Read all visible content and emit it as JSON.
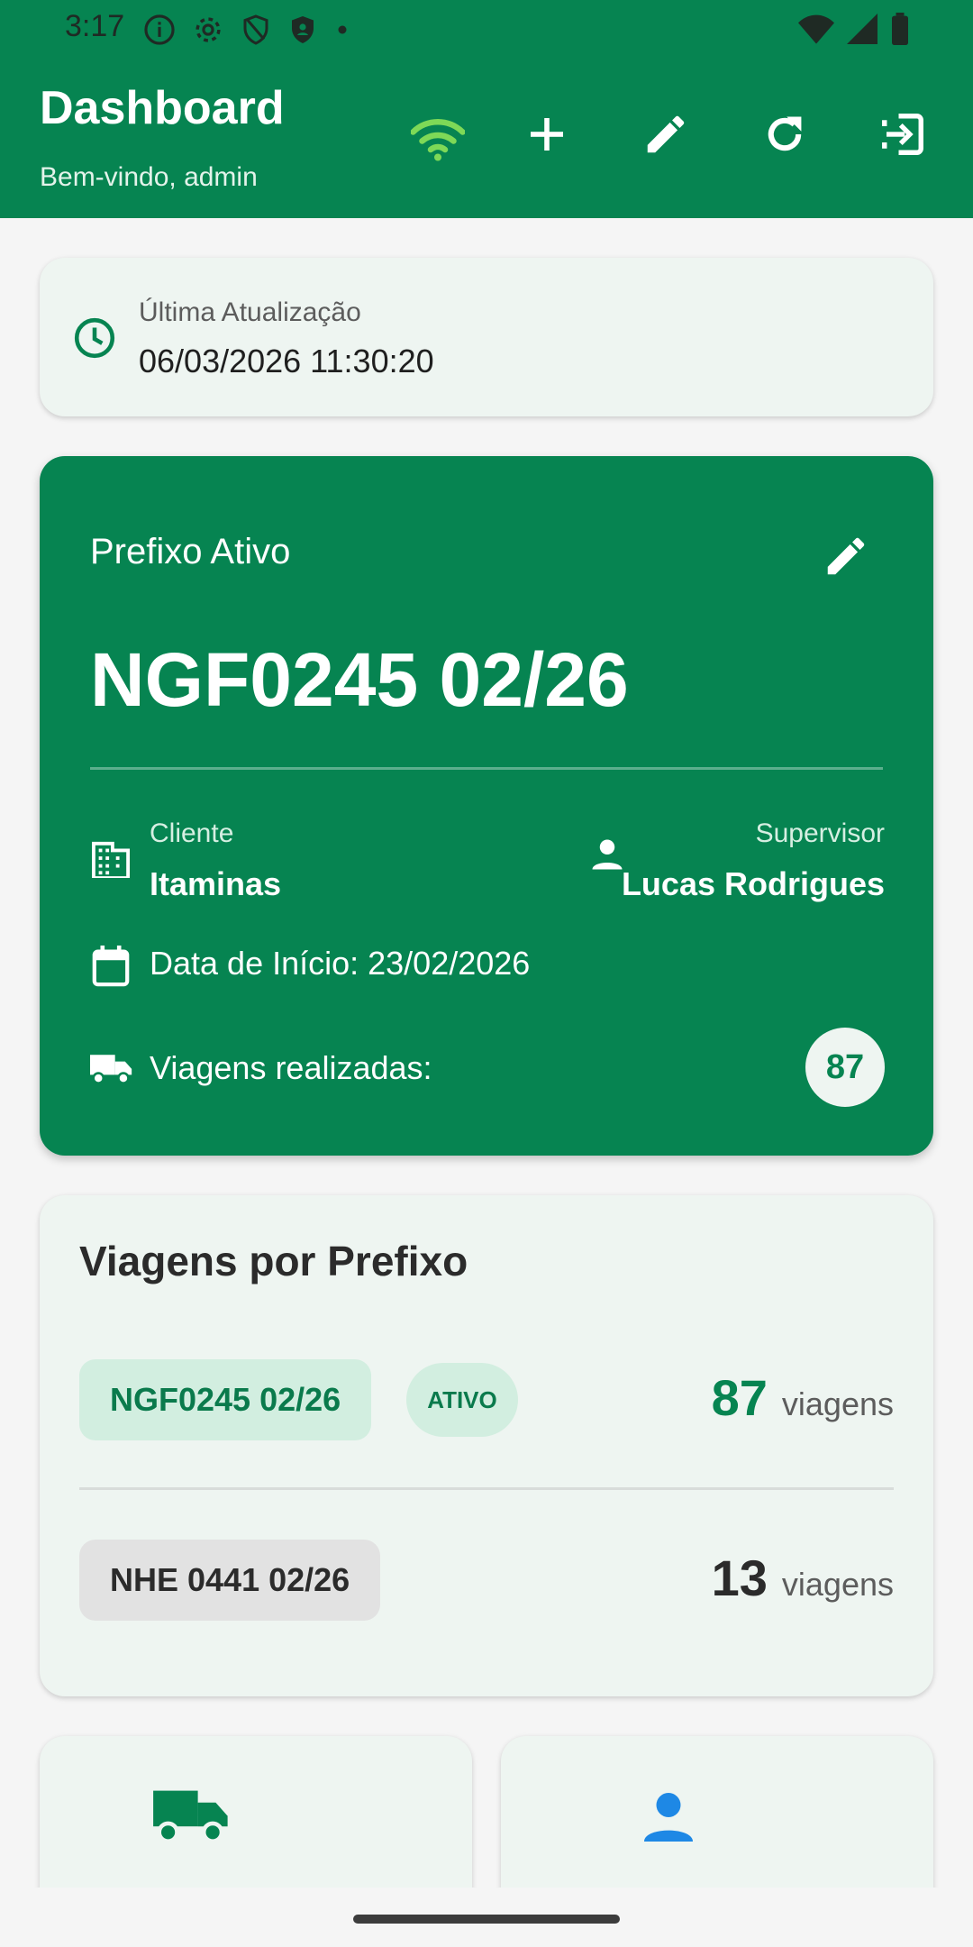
{
  "status_bar": {
    "time": "3:17"
  },
  "header": {
    "title": "Dashboard",
    "subtitle": "Bem-vindo, admin",
    "actions": [
      "wifi-icon",
      "add-icon",
      "edit-icon",
      "refresh-icon",
      "logout-icon"
    ]
  },
  "last_update": {
    "label": "Última Atualização",
    "value": "06/03/2026 11:30:20"
  },
  "active_prefix": {
    "label": "Prefixo Ativo",
    "prefix": "NGF0245 02/26",
    "cliente_label": "Cliente",
    "cliente_value": "Itaminas",
    "supervisor_label": "Supervisor",
    "supervisor_value": "Lucas Rodrigues",
    "start_date": "Data de Início: 23/02/2026",
    "trips_label": "Viagens realizadas:",
    "trips_count": "87"
  },
  "trips_by_prefix": {
    "title": "Viagens por Prefixo",
    "rows": [
      {
        "prefix": "NGF0245 02/26",
        "status": "ATIVO",
        "count": "87",
        "unit": "viagens"
      },
      {
        "prefix": "NHE 0441 02/26",
        "count": "13",
        "unit": "viagens"
      }
    ]
  },
  "colors": {
    "primary": "#068451",
    "card_bg": "#eef5f1",
    "wifi": "#7ed957",
    "person_blue": "#1e88e5"
  }
}
